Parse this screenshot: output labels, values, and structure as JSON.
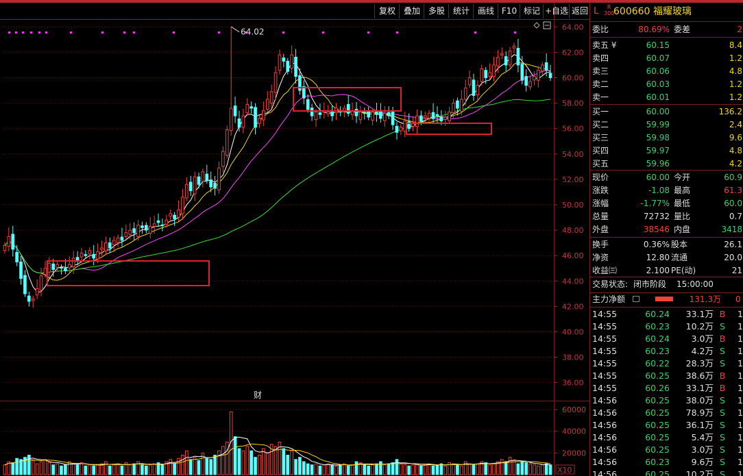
{
  "toolbar": {
    "buttons": [
      "复权",
      "叠加",
      "多股",
      "统计",
      "画线",
      "F10",
      "标记",
      "+自选",
      "返回"
    ]
  },
  "stock": {
    "prefix": "L",
    "flag_top": "R",
    "flag_bottom": "300",
    "code": "600660",
    "name": "福耀玻璃"
  },
  "order_book": {
    "weibi_label": "委比",
    "weibi_value": "80.69%",
    "weicha_label": "委差",
    "weicha_value": "2",
    "asks": [
      {
        "label": "卖五 ¥",
        "price": "60.15",
        "vol": "8.4"
      },
      {
        "label": "卖四",
        "price": "60.07",
        "vol": "1.2"
      },
      {
        "label": "卖三",
        "price": "60.06",
        "vol": "4.8"
      },
      {
        "label": "卖二",
        "price": "60.03",
        "vol": "1.2"
      },
      {
        "label": "卖一",
        "price": "60.01",
        "vol": "1.2"
      }
    ],
    "bids": [
      {
        "label": "买一",
        "price": "60.00",
        "vol": "136.2"
      },
      {
        "label": "买二",
        "price": "59.99",
        "vol": "2.4"
      },
      {
        "label": "买三",
        "price": "59.98",
        "vol": "9.6"
      },
      {
        "label": "买四",
        "price": "59.97",
        "vol": "4.8"
      },
      {
        "label": "买五",
        "price": "59.96",
        "vol": "4.2"
      }
    ]
  },
  "quote": [
    {
      "l1": "现价",
      "v1": "60.00",
      "c1": "green",
      "l2": "今开",
      "v2": "60.9",
      "c2": "green"
    },
    {
      "l1": "涨跌",
      "v1": "-1.08",
      "c1": "green",
      "l2": "最高",
      "v2": "61.3",
      "c2": "red"
    },
    {
      "l1": "涨幅",
      "v1": "-1.77%",
      "c1": "green",
      "l2": "最低",
      "v2": "60.0",
      "c2": "green"
    },
    {
      "l1": "总量",
      "v1": "72732",
      "c1": "white",
      "l2": "量比",
      "v2": "0.7",
      "c2": "white"
    },
    {
      "l1": "外盘",
      "v1": "38546",
      "c1": "red",
      "l2": "内盘",
      "v2": "3418",
      "c2": "green"
    }
  ],
  "fundamentals": [
    {
      "l1": "换手",
      "v1": "0.36%",
      "l2": "股本",
      "v2": "26.1"
    },
    {
      "l1": "净资",
      "v1": "12.80",
      "l2": "流通",
      "v2": "20.0"
    },
    {
      "l1": "收益㈢",
      "v1": "2.100",
      "l2": "PE(动)",
      "v2": "21"
    }
  ],
  "status": {
    "label": "交易状态:",
    "value": "闭市阶段",
    "time": "15:00:00"
  },
  "main_flow": {
    "label": "主力净额",
    "value": "131.3万",
    "tail": "0"
  },
  "ticks": [
    {
      "t": "14:55",
      "p": "60.24",
      "q": "33.1万",
      "d": "B"
    },
    {
      "t": "14:55",
      "p": "60.23",
      "q": "10.2万",
      "d": "S"
    },
    {
      "t": "14:55",
      "p": "60.24",
      "q": "3.0万",
      "d": "B"
    },
    {
      "t": "14:55",
      "p": "60.23",
      "q": "4.2万",
      "d": "S"
    },
    {
      "t": "14:55",
      "p": "60.22",
      "q": "28.3万",
      "d": "S"
    },
    {
      "t": "14:55",
      "p": "60.25",
      "q": "38.6万",
      "d": "B"
    },
    {
      "t": "14:55",
      "p": "60.26",
      "q": "33.1万",
      "d": "B"
    },
    {
      "t": "14:56",
      "p": "60.25",
      "q": "38.0万",
      "d": "S"
    },
    {
      "t": "14:56",
      "p": "60.25",
      "q": "78.9万",
      "d": "S"
    },
    {
      "t": "14:56",
      "p": "60.25",
      "q": "36.1万",
      "d": "S"
    },
    {
      "t": "14:56",
      "p": "60.25",
      "q": "5.4万",
      "d": "S"
    },
    {
      "t": "14:56",
      "p": "60.25",
      "q": "3.0万",
      "d": "S"
    },
    {
      "t": "14:56",
      "p": "60.23",
      "q": "9.6万",
      "d": "S"
    },
    {
      "t": "14:56",
      "p": "60.25",
      "q": "10.2万",
      "d": "S"
    }
  ],
  "chart": {
    "max_label": "64.02",
    "price_ticks": [
      "64.00",
      "62.00",
      "60.00",
      "58.00",
      "56.00",
      "54.00",
      "52.00",
      "50.00",
      "48.00",
      "46.00",
      "44.00",
      "42.00",
      "40.00",
      "38.00",
      "36.00"
    ],
    "volume_ticks": [
      "60000",
      "40000",
      "20000"
    ],
    "volume_unit": "X10",
    "event_marker": "财"
  },
  "chart_data": {
    "type": "candlestick",
    "ylim": [
      35.5,
      64.5
    ],
    "volume_ylim": [
      0,
      60000
    ],
    "closes": [
      46.8,
      47.5,
      46.5,
      45.5,
      44.2,
      43.0,
      42.4,
      42.6,
      43.4,
      44.4,
      45.0,
      45.4,
      44.9,
      45.3,
      45.0,
      44.8,
      45.3,
      45.8,
      45.6,
      46.2,
      46.0,
      46.4,
      45.8,
      46.3,
      46.6,
      47.0,
      46.6,
      47.2,
      47.4,
      47.2,
      47.8,
      48.0,
      47.8,
      48.4,
      48.2,
      48.0,
      48.3,
      48.5,
      48.6,
      48.4,
      48.8,
      49.3,
      48.9,
      49.6,
      50.6,
      51.6,
      51.1,
      52.2,
      51.6,
      52.6,
      51.9,
      51.4,
      51.3,
      52.9,
      54.2,
      55.9,
      57.6,
      57.0,
      56.1,
      57.0,
      57.9,
      57.6,
      56.1,
      56.8,
      57.4,
      58.3,
      58.9,
      60.4,
      61.8,
      61.3,
      60.5,
      61.8,
      60.1,
      59.0,
      58.4,
      57.5,
      57.0,
      57.3,
      57.1,
      57.4,
      57.3,
      57.0,
      57.6,
      57.3,
      57.6,
      57.2,
      57.4,
      57.0,
      57.3,
      57.2,
      56.9,
      57.3,
      57.1,
      56.8,
      57.2,
      57.0,
      56.3,
      55.7,
      56.1,
      56.6,
      56.0,
      56.4,
      57.0,
      56.6,
      57.0,
      57.2,
      56.8,
      57.0,
      56.6,
      56.9,
      57.3,
      58.0,
      57.6,
      58.3,
      59.2,
      60.0,
      58.6,
      59.4,
      60.7,
      60.0,
      60.4,
      61.0,
      61.6,
      61.9,
      61.0,
      62.1,
      62.5,
      61.0,
      59.8,
      59.4,
      59.7,
      60.1,
      60.6,
      61.0,
      60.6,
      60.0
    ],
    "volumes": [
      9000,
      12000,
      11000,
      15000,
      14000,
      16000,
      18000,
      13000,
      10000,
      12000,
      14000,
      11000,
      9000,
      10000,
      8000,
      9000,
      12000,
      10000,
      9000,
      11000,
      8000,
      9000,
      8000,
      9000,
      10000,
      12000,
      8000,
      9000,
      10000,
      8000,
      11000,
      9000,
      10000,
      12000,
      9000,
      8000,
      9000,
      10000,
      11000,
      9000,
      12000,
      14000,
      10000,
      15000,
      18000,
      22000,
      14000,
      16000,
      13000,
      20000,
      15000,
      14000,
      18000,
      22000,
      26000,
      30000,
      58000,
      35000,
      24000,
      22000,
      26000,
      22000,
      16000,
      18000,
      24000,
      20000,
      28000,
      26000,
      30000,
      24000,
      18000,
      22000,
      14000,
      16000,
      12000,
      10000,
      9000,
      10000,
      8000,
      9000,
      10000,
      9000,
      8000,
      9000,
      10000,
      8000,
      9000,
      12000,
      11000,
      9000,
      8000,
      9000,
      10000,
      12000,
      9000,
      10000,
      11000,
      14000,
      10000,
      9000,
      8000,
      9000,
      10000,
      8000,
      9000,
      10000,
      8000,
      9000,
      10000,
      8000,
      11000,
      10000,
      9000,
      8000,
      12000,
      10000,
      9000,
      10000,
      12000,
      11000,
      9000,
      10000,
      12000,
      14000,
      12000,
      16000,
      13000,
      10000,
      12000,
      11000,
      10000,
      9000,
      8000,
      9000,
      10000,
      9000
    ]
  }
}
